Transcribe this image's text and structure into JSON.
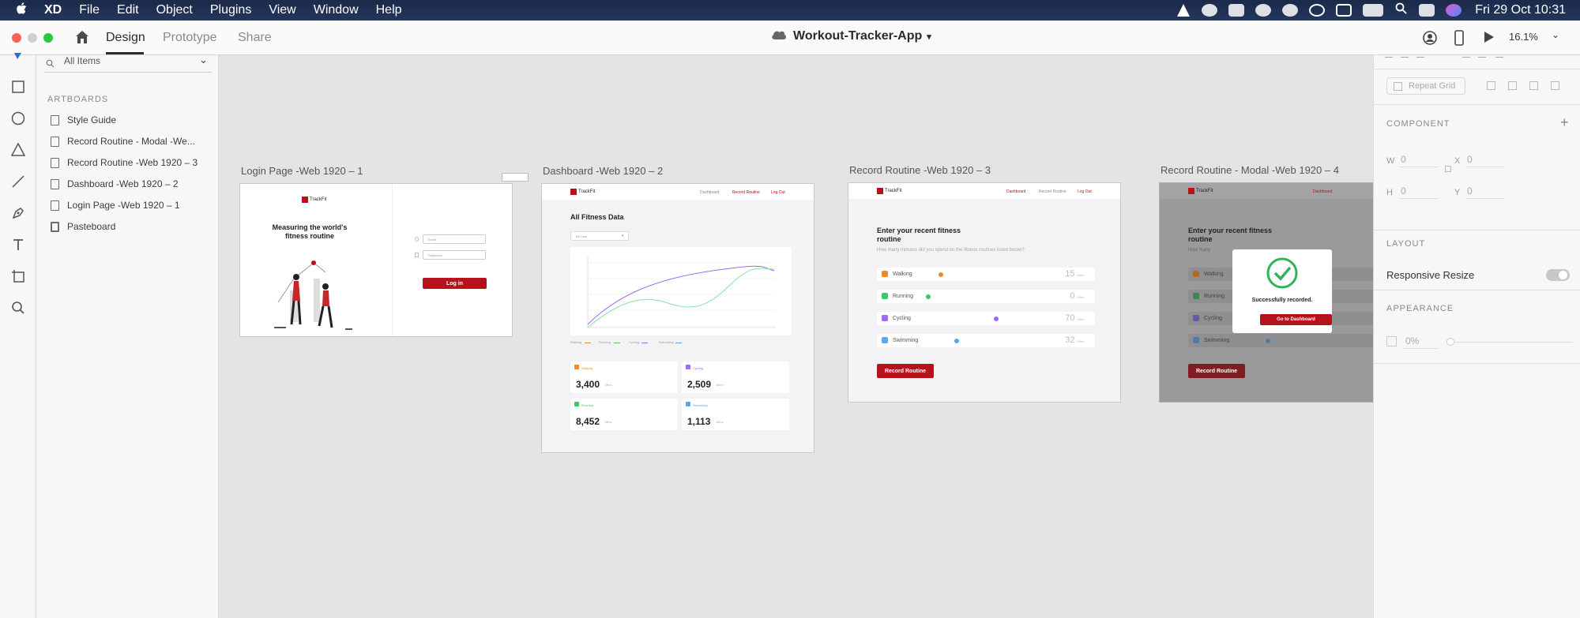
{
  "menubar": {
    "apple_icon": "apple-icon",
    "app": "XD",
    "items": [
      "File",
      "Edit",
      "Object",
      "Plugins",
      "View",
      "Window",
      "Help"
    ],
    "clock": "Fri 29 Oct  10:31"
  },
  "appbar": {
    "tabs": [
      "Design",
      "Prototype",
      "Share"
    ],
    "title": "Workout-Tracker-App",
    "zoom": "16.1%"
  },
  "layers": {
    "search_value": "All Items",
    "section": "ARTBOARDS",
    "items": [
      "Style Guide",
      "Record Routine - Modal -We...",
      "Record Routine -Web 1920 – 3",
      "Dashboard -Web 1920 – 2",
      "Login Page -Web 1920 – 1",
      "Pasteboard"
    ]
  },
  "artboards": {
    "login": {
      "label": "Login Page -Web 1920 – 1",
      "logo": "TrackFit",
      "headline_1": "Measuring the world's",
      "headline_2": "fitness routine",
      "email_placeholder": "Email",
      "password_placeholder": "Password",
      "login_button": "Log in"
    },
    "dashboard": {
      "label": "Dashboard -Web 1920 – 2",
      "logo": "TrackFit",
      "nav": [
        "Dashboard",
        "Record Routine",
        "Log Out"
      ],
      "heading": "All Fitness Data",
      "filter": "All Time",
      "legend": [
        "Walking",
        "Running",
        "Cycling",
        "Swimming"
      ],
      "stats": [
        {
          "name": "Walking",
          "value": "3,400",
          "unit": "Mins",
          "color": "#f08a24"
        },
        {
          "name": "Cycling",
          "value": "2,509",
          "unit": "Mins",
          "color": "#9b6bf0"
        },
        {
          "name": "Running",
          "value": "8,452",
          "unit": "Mins",
          "color": "#3dc96a"
        },
        {
          "name": "Swimming",
          "value": "1,113",
          "unit": "Mins",
          "color": "#5aa6f0"
        }
      ]
    },
    "record": {
      "label": "Record Routine -Web 1920 – 3",
      "logo": "TrackFit",
      "nav": [
        "Dashboard",
        "Record Routine",
        "Log Out"
      ],
      "heading_1": "Enter your recent fitness",
      "heading_2": "routine",
      "sub": "How many minutes did you spend on the fitness routines listed below?",
      "rows": [
        {
          "name": "Walking",
          "value": "15",
          "unit": "Mins",
          "color": "#f08a24"
        },
        {
          "name": "Running",
          "value": "0",
          "unit": "Mins",
          "color": "#3dc96a"
        },
        {
          "name": "Cycling",
          "value": "70",
          "unit": "Mins",
          "color": "#9b6bf0"
        },
        {
          "name": "Swimming",
          "value": "32",
          "unit": "Mins",
          "color": "#5aa6f0"
        }
      ],
      "button": "Record Routine"
    },
    "modal": {
      "label": "Record Routine - Modal -Web 1920 – 4",
      "logo": "TrackFit",
      "nav": [
        "Dashboard"
      ],
      "heading_1": "Enter your recent fitness",
      "heading_2": "routine",
      "sub": "How many",
      "rows": [
        "Walking",
        "Running",
        "Cycling",
        "Swimming"
      ],
      "success_text": "Successfully recorded.",
      "success_button": "Go to Dashboard",
      "button": "Record Routine"
    }
  },
  "props": {
    "repeat_grid": "Repeat Grid",
    "component": "COMPONENT",
    "w_label": "W",
    "w_value": "0",
    "x_label": "X",
    "x_value": "0",
    "h_label": "H",
    "h_value": "0",
    "y_label": "Y",
    "y_value": "0",
    "layout": "LAYOUT",
    "responsive_resize": "Responsive Resize",
    "appearance": "APPEARANCE",
    "opacity": "0%"
  },
  "colors": {
    "brand_red": "#b5121b",
    "walking": "#f08a24",
    "running": "#3dc96a",
    "cycling": "#9b6bf0",
    "swimming": "#5aa6f0",
    "success": "#2fb45a"
  }
}
